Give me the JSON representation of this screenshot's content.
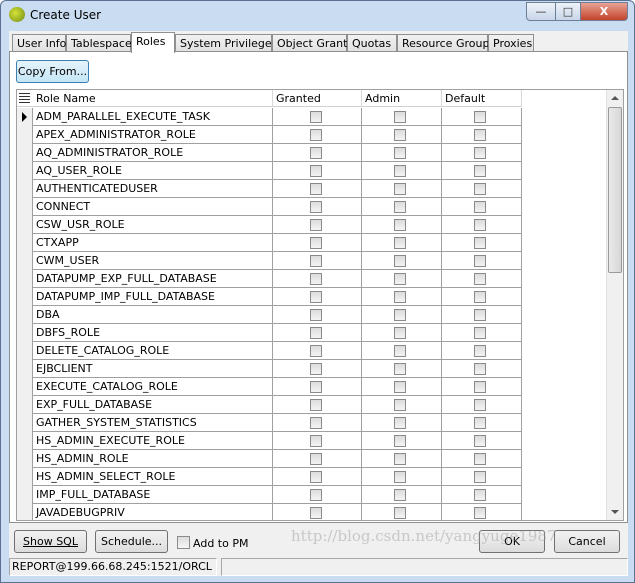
{
  "window": {
    "title": "Create User",
    "minimize": "—",
    "maximize": "□",
    "close": "X"
  },
  "tabs": [
    {
      "label": "User Info"
    },
    {
      "label": "Tablespace"
    },
    {
      "label": "Roles",
      "active": true
    },
    {
      "label": "System Privileges"
    },
    {
      "label": "Object Grants"
    },
    {
      "label": "Quotas"
    },
    {
      "label": "Resource Groups"
    },
    {
      "label": "Proxies"
    }
  ],
  "copy_from": "Copy From...",
  "grid": {
    "columns": [
      "Role Name",
      "Granted",
      "Admin",
      "Default"
    ],
    "rows": [
      {
        "name": "ADM_PARALLEL_EXECUTE_TASK",
        "current": true,
        "granted": false,
        "admin": false,
        "default": false
      },
      {
        "name": "APEX_ADMINISTRATOR_ROLE"
      },
      {
        "name": "AQ_ADMINISTRATOR_ROLE"
      },
      {
        "name": "AQ_USER_ROLE"
      },
      {
        "name": "AUTHENTICATEDUSER"
      },
      {
        "name": "CONNECT"
      },
      {
        "name": "CSW_USR_ROLE"
      },
      {
        "name": "CTXAPP"
      },
      {
        "name": "CWM_USER"
      },
      {
        "name": "DATAPUMP_EXP_FULL_DATABASE"
      },
      {
        "name": "DATAPUMP_IMP_FULL_DATABASE"
      },
      {
        "name": "DBA"
      },
      {
        "name": "DBFS_ROLE"
      },
      {
        "name": "DELETE_CATALOG_ROLE"
      },
      {
        "name": "EJBCLIENT"
      },
      {
        "name": "EXECUTE_CATALOG_ROLE"
      },
      {
        "name": "EXP_FULL_DATABASE"
      },
      {
        "name": "GATHER_SYSTEM_STATISTICS"
      },
      {
        "name": "HS_ADMIN_EXECUTE_ROLE"
      },
      {
        "name": "HS_ADMIN_ROLE"
      },
      {
        "name": "HS_ADMIN_SELECT_ROLE"
      },
      {
        "name": "IMP_FULL_DATABASE"
      },
      {
        "name": "JAVADEBUGPRIV"
      }
    ]
  },
  "footer": {
    "show_sql": "Show SQL",
    "schedule": "Schedule...",
    "add_to_pm": "Add to PM",
    "add_to_pm_checked": false,
    "ok": "OK",
    "cancel": "Cancel"
  },
  "status": {
    "connection": "REPORT@199.66.68.245:1521/ORCL"
  },
  "watermark": "http://blog.csdn.net/yangyuge1987"
}
